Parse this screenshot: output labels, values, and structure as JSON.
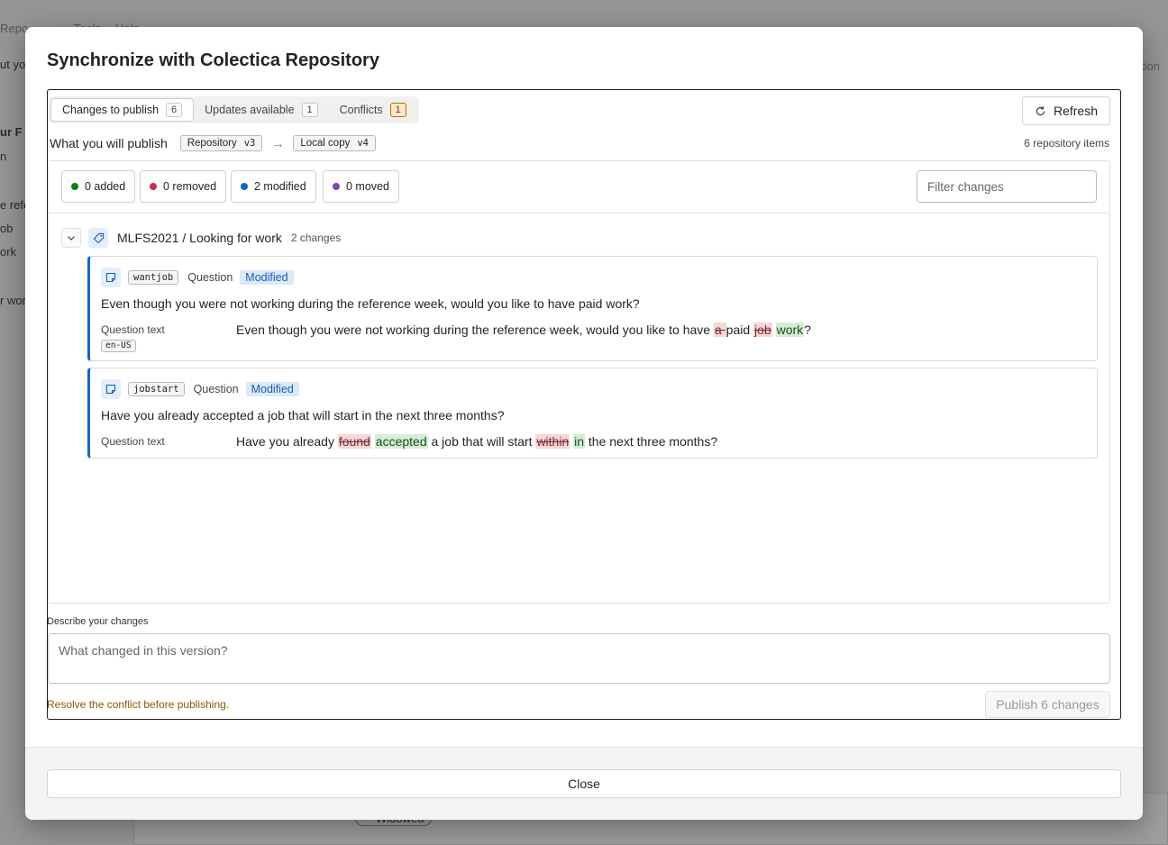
{
  "background": {
    "texts": [
      "Repo",
      "Tools",
      "Help",
      "ut yo",
      "ur F",
      "n",
      "e refe",
      "ob",
      "ork",
      "r wor",
      "tion",
      "Widowed"
    ]
  },
  "dialog": {
    "title": "Synchronize with Colectica Repository",
    "tabs": [
      {
        "label": "Changes to publish",
        "count": "6"
      },
      {
        "label": "Updates available",
        "count": "1"
      },
      {
        "label": "Conflicts",
        "count": "1"
      }
    ],
    "refresh_label": "Refresh",
    "publish_summary": {
      "label": "What you will publish",
      "from_label": "Repository",
      "from_version": "v3",
      "to_label": "Local copy",
      "to_version": "v4",
      "items_count": "6 repository items"
    },
    "filters": {
      "added": "0 added",
      "removed": "0 removed",
      "modified": "2 modified",
      "moved": "0 moved",
      "placeholder": "Filter changes",
      "colors": {
        "added": "#107c10",
        "removed": "#c4314b",
        "modified": "#0f6cbd",
        "moved": "#8246af"
      }
    },
    "group": {
      "title": "MLFS2021 / Looking for work",
      "changes": "2 changes",
      "items": [
        {
          "code": "wantjob",
          "type": "Question",
          "status": "Modified",
          "question": "Even though you were not working during the reference week, would you like to have paid work?",
          "field_label": "Question text",
          "lang": "en-US",
          "diff": {
            "prefix": "Even though you were not working during the reference week, would you like to have ",
            "del1": "a ",
            "mid1": "paid ",
            "del2": "job",
            "ins2": "work",
            "suffix": "?"
          }
        },
        {
          "code": "jobstart",
          "type": "Question",
          "status": "Modified",
          "question": "Have you already accepted a job that will start in the next three months?",
          "field_label": "Question text",
          "diff": {
            "prefix": "Have you already ",
            "del1": "found",
            "ins1": "accepted",
            "mid1": " a job that will start ",
            "del2": "within",
            "ins2": "in",
            "suffix": " the next three months?"
          }
        }
      ]
    },
    "describe_label": "Describe your changes",
    "describe_placeholder": "What changed in this version?",
    "warning": "Resolve the conflict before publishing.",
    "publish_button": "Publish 6 changes",
    "close_button": "Close"
  }
}
